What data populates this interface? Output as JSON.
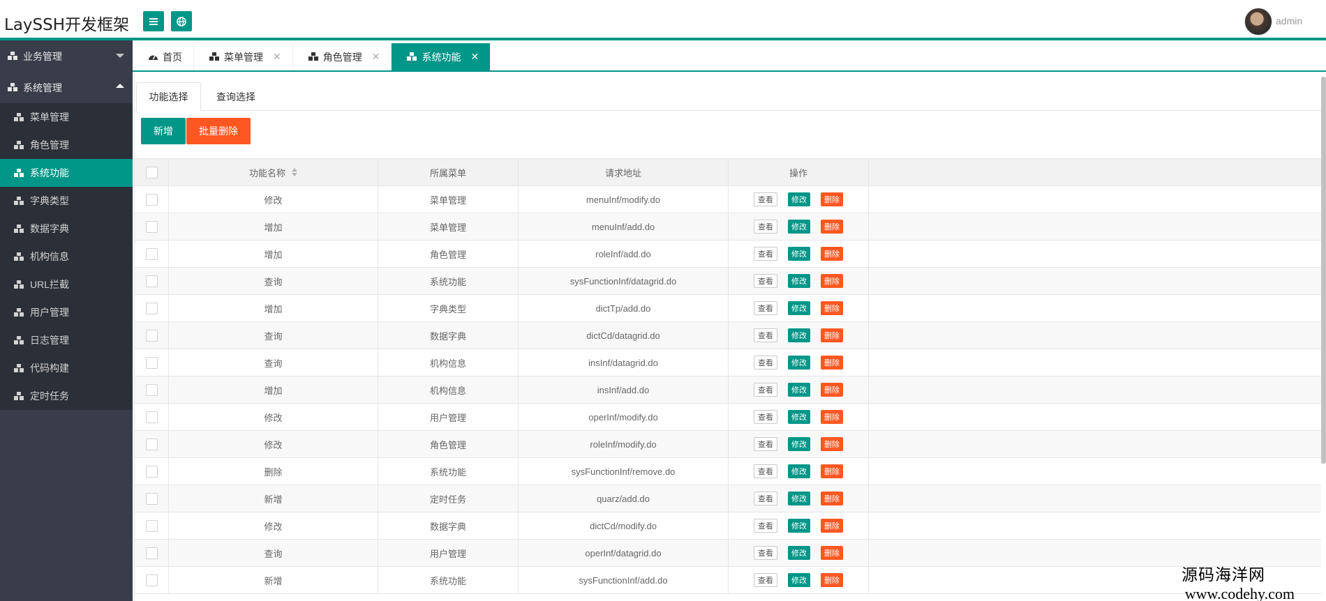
{
  "header": {
    "title": "LaySSH开发框架",
    "user": "admin"
  },
  "sidebar": {
    "groups": [
      {
        "label": "业务管理",
        "expanded": false
      },
      {
        "label": "系统管理",
        "expanded": true
      }
    ],
    "items": [
      {
        "label": "菜单管理",
        "active": false
      },
      {
        "label": "角色管理",
        "active": false
      },
      {
        "label": "系统功能",
        "active": true
      },
      {
        "label": "字典类型",
        "active": false
      },
      {
        "label": "数据字典",
        "active": false
      },
      {
        "label": "机构信息",
        "active": false
      },
      {
        "label": "URL拦截",
        "active": false
      },
      {
        "label": "用户管理",
        "active": false
      },
      {
        "label": "日志管理",
        "active": false
      },
      {
        "label": "代码构建",
        "active": false
      },
      {
        "label": "定时任务",
        "active": false
      }
    ]
  },
  "tabs": [
    {
      "label": "首页",
      "closable": false,
      "active": false
    },
    {
      "label": "菜单管理",
      "closable": true,
      "active": false
    },
    {
      "label": "角色管理",
      "closable": true,
      "active": false
    },
    {
      "label": "系统功能",
      "closable": true,
      "active": true
    }
  ],
  "subtabs": [
    "功能选择",
    "查询选择"
  ],
  "toolbar": {
    "add": "新增",
    "batch_delete": "批量删除"
  },
  "table": {
    "columns": [
      "功能名称",
      "所属菜单",
      "请求地址",
      "操作"
    ],
    "actions": {
      "view": "查看",
      "edit": "修改",
      "remove": "删除"
    },
    "rows": [
      [
        "修改",
        "菜单管理",
        "menuInf/modify.do"
      ],
      [
        "增加",
        "菜单管理",
        "menuInf/add.do"
      ],
      [
        "增加",
        "角色管理",
        "roleInf/add.do"
      ],
      [
        "查询",
        "系统功能",
        "sysFunctionInf/datagrid.do"
      ],
      [
        "增加",
        "字典类型",
        "dictTp/add.do"
      ],
      [
        "查询",
        "数据字典",
        "dictCd/datagrid.do"
      ],
      [
        "查询",
        "机构信息",
        "insInf/datagrid.do"
      ],
      [
        "增加",
        "机构信息",
        "insInf/add.do"
      ],
      [
        "修改",
        "用户管理",
        "operInf/modify.do"
      ],
      [
        "修改",
        "角色管理",
        "roleInf/modify.do"
      ],
      [
        "删除",
        "系统功能",
        "sysFunctionInf/remove.do"
      ],
      [
        "新增",
        "定时任务",
        "quarz/add.do"
      ],
      [
        "修改",
        "数据字典",
        "dictCd/modify.do"
      ],
      [
        "查询",
        "用户管理",
        "operInf/datagrid.do"
      ],
      [
        "新增",
        "系统功能",
        "sysFunctionInf/add.do"
      ]
    ]
  },
  "watermark": {
    "line1": "源码海洋网",
    "line2": "www.codehy.com"
  },
  "colors": {
    "accent": "#009688",
    "danger": "#ff5722",
    "sidebar": "#393d49"
  }
}
